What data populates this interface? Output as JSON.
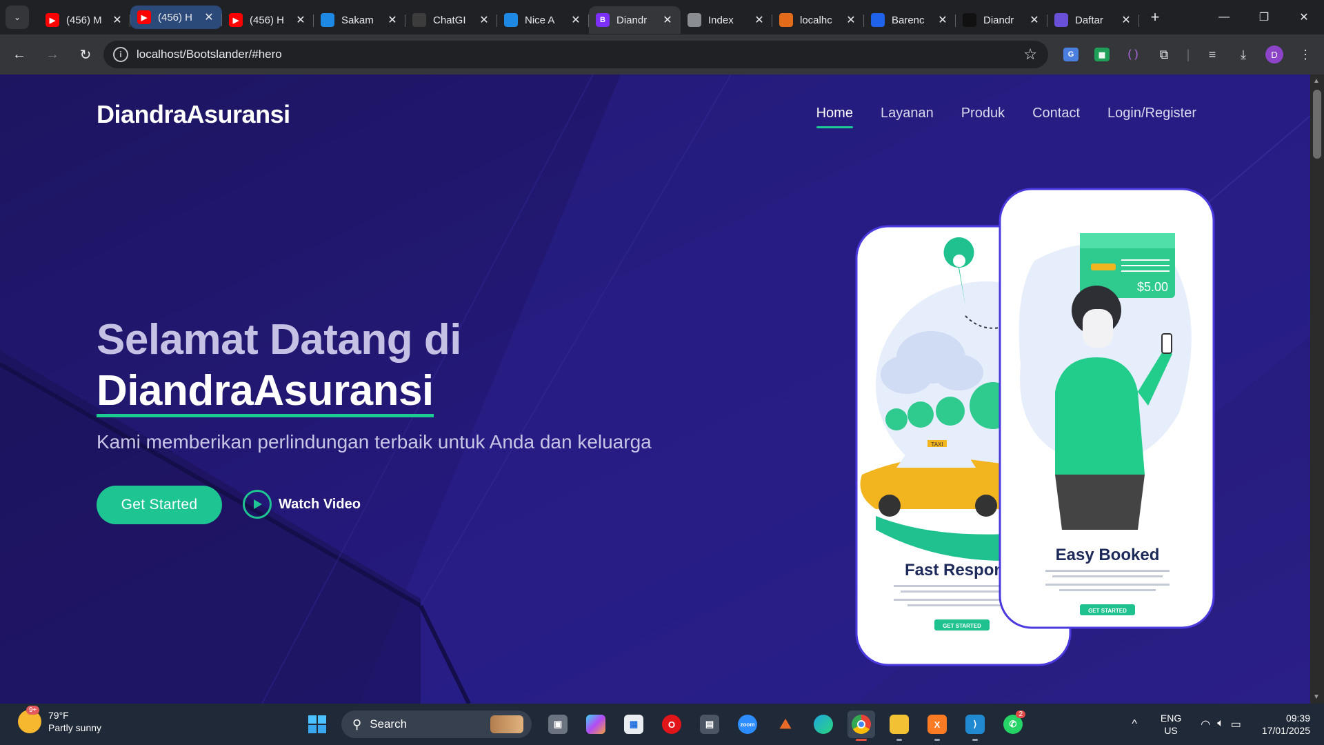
{
  "browser": {
    "tabs": [
      {
        "title": "(456) M",
        "icon": "youtube-icon",
        "color": "#ff0000"
      },
      {
        "title": "(456) H",
        "icon": "youtube-icon",
        "color": "#ff0000",
        "highlighted": true
      },
      {
        "title": "(456) H",
        "icon": "youtube-icon",
        "color": "#ff0000"
      },
      {
        "title": "Sakam",
        "icon": "document-icon",
        "color": "#1e88e5"
      },
      {
        "title": "ChatGI",
        "icon": "chatgpt-icon",
        "color": "#3c3c3c"
      },
      {
        "title": "Nice A",
        "icon": "nice-admin-icon",
        "color": "#1e88e5"
      },
      {
        "title": "Diandr",
        "icon": "bootstrap-icon",
        "color": "#7b2ff7",
        "active": true
      },
      {
        "title": "Index",
        "icon": "globe-icon",
        "color": "#8a8d91"
      },
      {
        "title": "localhc",
        "icon": "xampp-icon",
        "color": "#e36b1a"
      },
      {
        "title": "Barenc",
        "icon": "bareng-icon",
        "color": "#1e63e9"
      },
      {
        "title": "Diandr",
        "icon": "github-icon",
        "color": "#111111"
      },
      {
        "title": "Daftar",
        "icon": "daftar-icon",
        "color": "#6a4fd8"
      }
    ],
    "url": "localhost/Bootslander/#hero",
    "profile_initial": "D"
  },
  "site": {
    "logo": "DiandraAsuransi",
    "nav": [
      "Home",
      "Layanan",
      "Produk",
      "Contact",
      "Login/Register"
    ],
    "hero": {
      "title_line1": "Selamat Datang di",
      "title_brand": "DiandraAsuransi",
      "subtitle": "Kami memberikan perlindungan terbaik untuk Anda dan keluarga",
      "cta": "Get Started",
      "watch": "Watch Video"
    },
    "phones": {
      "left_title": "Fast Respon",
      "left_button": "GET STARTED",
      "right_title": "Easy Booked",
      "right_button": "GET STARTED",
      "price": "$5.00",
      "taxi_sign": "TAXI"
    },
    "colors": {
      "background": "#221a66",
      "accent": "#1ec592",
      "phone_border": "#4b39e0"
    }
  },
  "taskbar": {
    "weather_temp": "79°F",
    "weather_desc": "Partly sunny",
    "weather_badge": "9+",
    "search_label": "Search",
    "whatsapp_badge": "2",
    "lang1": "ENG",
    "lang2": "US",
    "time": "09:39",
    "date": "17/01/2025"
  }
}
